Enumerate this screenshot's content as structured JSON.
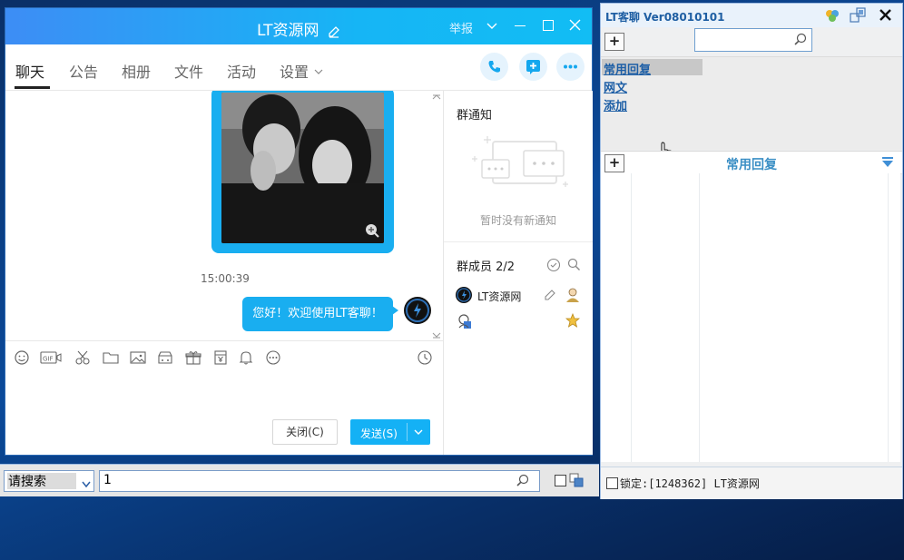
{
  "chat_window": {
    "title": "LT资源网",
    "title_buttons": {
      "report": "举报"
    },
    "tabs": [
      {
        "label": "聊天",
        "active": true
      },
      {
        "label": "公告"
      },
      {
        "label": "相册"
      },
      {
        "label": "文件"
      },
      {
        "label": "活动"
      },
      {
        "label": "设置"
      }
    ],
    "messages": {
      "timestamp": "15:00:39",
      "greeting": "您好！欢迎使用LT客聊！"
    },
    "buttons": {
      "close": "关闭(C)",
      "send": "发送(S)"
    },
    "colors": {
      "accent": "#14b1f5",
      "title_start": "#3d8df5"
    }
  },
  "group_panel": {
    "notice_title": "群通知",
    "notice_empty": "暂时没有新通知",
    "members_title": "群成员 2/2",
    "members": [
      {
        "name": "LT资源网"
      },
      {
        "name": ""
      }
    ]
  },
  "bottom_bar": {
    "search_select": "请搜索",
    "search_value": "1"
  },
  "lt_panel": {
    "title": "LT客聊 Ver08010101",
    "plus": "+",
    "quick_replies": [
      "常用回复",
      "网文",
      "添加"
    ],
    "section_title": "常用回复",
    "status_text": "锁定:[1248362] LT资源网"
  }
}
